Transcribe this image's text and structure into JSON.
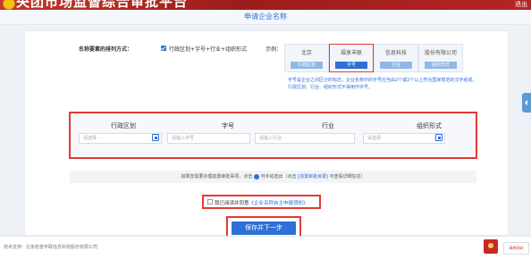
{
  "header": {
    "site_title": "央团市场监督综合审批平台",
    "top_right": "退出"
  },
  "page": {
    "title": "申请企业名称"
  },
  "order": {
    "label": "名称要素的排列方式：",
    "checked": true,
    "option_text": "行政区划+字号+行业+组织形式",
    "example_label": "示例：",
    "examples": [
      {
        "chars": "北京",
        "tag": "行政区划"
      },
      {
        "chars": "福享丰联",
        "tag": "字号"
      },
      {
        "chars": "信息科技",
        "tag": "行业"
      },
      {
        "chars": "股份有限公司",
        "tag": "组织形式"
      }
    ],
    "note": "字号是企业之间区分的标志，企业名称中的字号应当由2个或2个以上符合国家规范的汉字组成，行政区划、行业、组织形式不得用作字号。"
  },
  "fields": [
    {
      "label": "行政区划",
      "placeholder": "请选择",
      "has_button": true
    },
    {
      "label": "字号",
      "placeholder": "请输入字号",
      "has_button": false
    },
    {
      "label": "行业",
      "placeholder": "请输入行业",
      "has_button": false
    },
    {
      "label": "组织形式",
      "placeholder": "请选择",
      "has_button": true
    }
  ],
  "hint": {
    "prefix": "如果您需要办理前置审批事项，点击",
    "mid": "可手动选出（点击",
    "link": "[前置审批目录]",
    "suffix": "可查看详细信息）"
  },
  "agreement": {
    "checked": false,
    "prefix": "我已阅读并同意",
    "link": "《企业名称自主申报须知》"
  },
  "actions": {
    "save_label": "保存并下一步"
  },
  "footer": {
    "support": "技术支持：北京拓普丰联信息科技股份有限公司",
    "badge2_text": "政府网站"
  }
}
